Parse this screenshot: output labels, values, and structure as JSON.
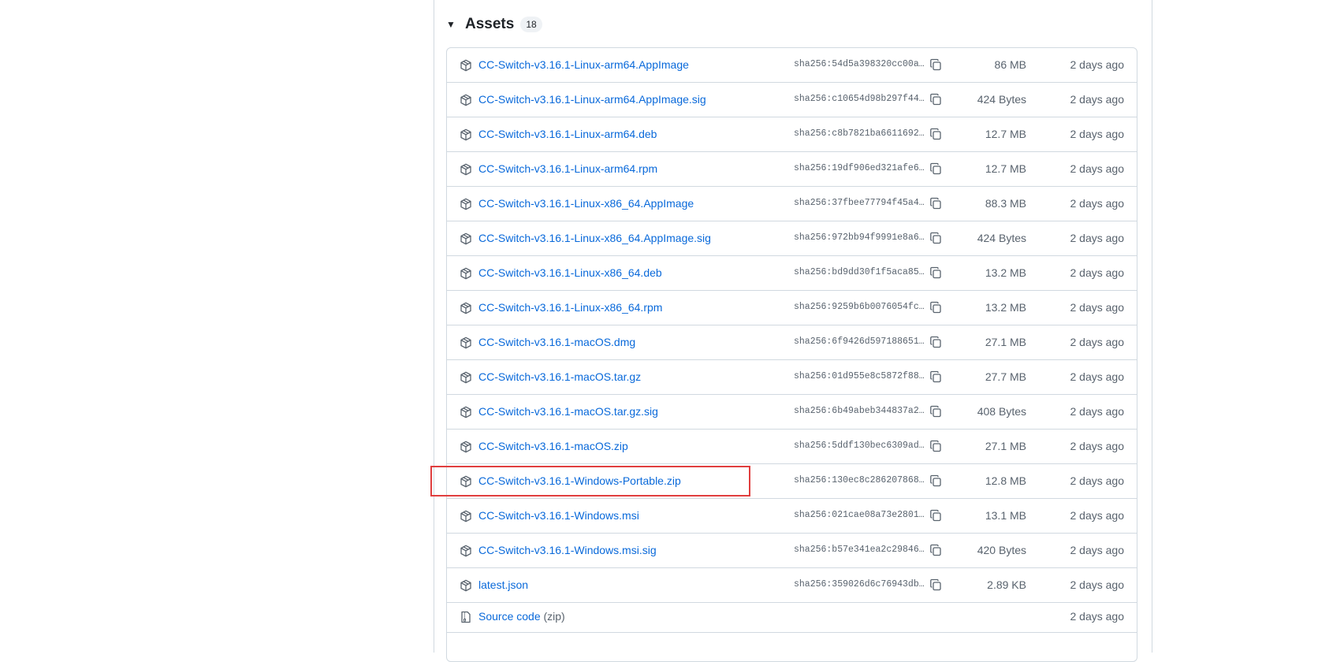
{
  "assets": {
    "title": "Assets",
    "count": "18",
    "rows": [
      {
        "name": "CC-Switch-v3.16.1-Linux-arm64.AppImage",
        "sha": "sha256:54d5a398320cc00a4…",
        "size": "86 MB",
        "date": "2 days ago"
      },
      {
        "name": "CC-Switch-v3.16.1-Linux-arm64.AppImage.sig",
        "sha": "sha256:c10654d98b297f445…",
        "size": "424 Bytes",
        "date": "2 days ago"
      },
      {
        "name": "CC-Switch-v3.16.1-Linux-arm64.deb",
        "sha": "sha256:c8b7821ba6611692a…",
        "size": "12.7 MB",
        "date": "2 days ago"
      },
      {
        "name": "CC-Switch-v3.16.1-Linux-arm64.rpm",
        "sha": "sha256:19df906ed321afe6e…",
        "size": "12.7 MB",
        "date": "2 days ago"
      },
      {
        "name": "CC-Switch-v3.16.1-Linux-x86_64.AppImage",
        "sha": "sha256:37fbee77794f45a4e…",
        "size": "88.3 MB",
        "date": "2 days ago"
      },
      {
        "name": "CC-Switch-v3.16.1-Linux-x86_64.AppImage.sig",
        "sha": "sha256:972bb94f9991e8a6f…",
        "size": "424 Bytes",
        "date": "2 days ago"
      },
      {
        "name": "CC-Switch-v3.16.1-Linux-x86_64.deb",
        "sha": "sha256:bd9dd30f1f5aca851…",
        "size": "13.2 MB",
        "date": "2 days ago"
      },
      {
        "name": "CC-Switch-v3.16.1-Linux-x86_64.rpm",
        "sha": "sha256:9259b6b0076054fce…",
        "size": "13.2 MB",
        "date": "2 days ago"
      },
      {
        "name": "CC-Switch-v3.16.1-macOS.dmg",
        "sha": "sha256:6f9426d5971886514…",
        "size": "27.1 MB",
        "date": "2 days ago"
      },
      {
        "name": "CC-Switch-v3.16.1-macOS.tar.gz",
        "sha": "sha256:01d955e8c5872f888…",
        "size": "27.7 MB",
        "date": "2 days ago"
      },
      {
        "name": "CC-Switch-v3.16.1-macOS.tar.gz.sig",
        "sha": "sha256:6b49abeb344837a20…",
        "size": "408 Bytes",
        "date": "2 days ago"
      },
      {
        "name": "CC-Switch-v3.16.1-macOS.zip",
        "sha": "sha256:5ddf130bec6309add…",
        "size": "27.1 MB",
        "date": "2 days ago"
      },
      {
        "name": "CC-Switch-v3.16.1-Windows-Portable.zip",
        "sha": "sha256:130ec8c286207868f…",
        "size": "12.8 MB",
        "date": "2 days ago"
      },
      {
        "name": "CC-Switch-v3.16.1-Windows.msi",
        "sha": "sha256:021cae08a73e2801c…",
        "size": "13.1 MB",
        "date": "2 days ago"
      },
      {
        "name": "CC-Switch-v3.16.1-Windows.msi.sig",
        "sha": "sha256:b57e341ea2c298461…",
        "size": "420 Bytes",
        "date": "2 days ago"
      },
      {
        "name": "latest.json",
        "sha": "sha256:359026d6c76943dba…",
        "size": "2.89 KB",
        "date": "2 days ago"
      }
    ],
    "source_zip": {
      "label": "Source code",
      "suffix": "(zip)",
      "date": "2 days ago"
    }
  },
  "colors": {
    "link": "#0969da",
    "muted": "#59636e",
    "highlight": "#e03e3e"
  },
  "icons": {
    "row": "package-icon",
    "copy": "copy-icon",
    "source": "file-zip-icon",
    "toggle": "triangle-down-icon"
  }
}
